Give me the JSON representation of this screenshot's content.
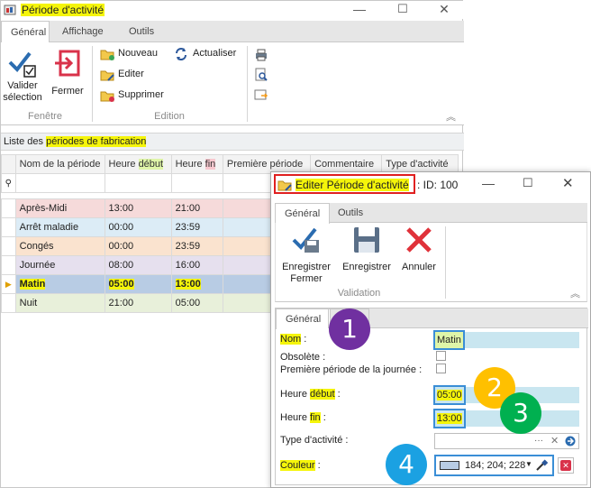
{
  "window": {
    "title": "Période d'activité",
    "tabs": [
      "Général",
      "Affichage",
      "Outils"
    ],
    "buttons": {
      "valider_line1": "Valider",
      "valider_line2": "sélection",
      "fermer": "Fermer",
      "nouveau": "Nouveau",
      "actualiser": "Actualiser",
      "editer": "Editer",
      "supprimer": "Supprimer"
    },
    "groups": {
      "fenetre": "Fenêtre",
      "edition": "Edition"
    }
  },
  "list": {
    "header_prefix": "Liste des ",
    "header_highlight": "périodes de fabrication",
    "columns": {
      "nom": "Nom de la période",
      "debut_prefix": "Heure ",
      "debut_hl": "début",
      "fin_prefix": "Heure ",
      "fin_hl": "fin",
      "premiere": "Première période",
      "commentaire": "Commentaire",
      "type": "Type d'activité"
    },
    "rows": [
      {
        "nom": "Après-Midi",
        "debut": "13:00",
        "fin": "21:00",
        "color": "#f6dada"
      },
      {
        "nom": "Arrêt maladie",
        "debut": "00:00",
        "fin": "23:59",
        "color": "#dcecf6"
      },
      {
        "nom": "Congés",
        "debut": "00:00",
        "fin": "23:59",
        "color": "#fae3cf"
      },
      {
        "nom": "Journée",
        "debut": "08:00",
        "fin": "16:00",
        "color": "#e6e0ee"
      },
      {
        "nom": "Matin",
        "debut": "05:00",
        "fin": "13:00",
        "color": "#b8cce4"
      },
      {
        "nom": "Nuit",
        "debut": "21:00",
        "fin": "05:00",
        "color": "#e8f0da"
      }
    ]
  },
  "dialog": {
    "title": "Editer Période d'activité",
    "id_text": ": ID: 100",
    "tabs": [
      "Général",
      "Outils"
    ],
    "buttons": {
      "enregistrer_fermer_l1": "Enregistrer",
      "enregistrer_fermer_l2": "Fermer",
      "enregistrer": "Enregistrer",
      "annuler": "Annuler"
    },
    "group_validation": "Validation",
    "inner_tab": "Général",
    "form": {
      "nom_label": "Nom",
      "nom_colon": " :",
      "nom_value": "Matin",
      "obsolete_label": "Obsolète :",
      "premiere_label": "Première période de la journée :",
      "debut_prefix": "Heure ",
      "debut_hl": "début",
      "debut_colon": " :",
      "debut_value": "05:00",
      "fin_prefix": "Heure ",
      "fin_hl": "fin",
      "fin_colon": " :",
      "fin_value": "13:00",
      "type_label": "Type d'activité :",
      "couleur_label": "Couleur",
      "couleur_colon": " :",
      "couleur_value": "184; 204; 228",
      "couleur_swatch": "#b8cce4"
    },
    "type_icons": {
      "more": "···",
      "clear": "✕"
    }
  },
  "badges": [
    {
      "n": "1",
      "color": "#7030a0"
    },
    {
      "n": "2",
      "color": "#ffc000"
    },
    {
      "n": "3",
      "color": "#00b050"
    },
    {
      "n": "4",
      "color": "#1ba1e2"
    }
  ],
  "colors": {
    "highlight": "#f5f50a",
    "accent": "#2b579a",
    "field": "#c9e6f0"
  }
}
